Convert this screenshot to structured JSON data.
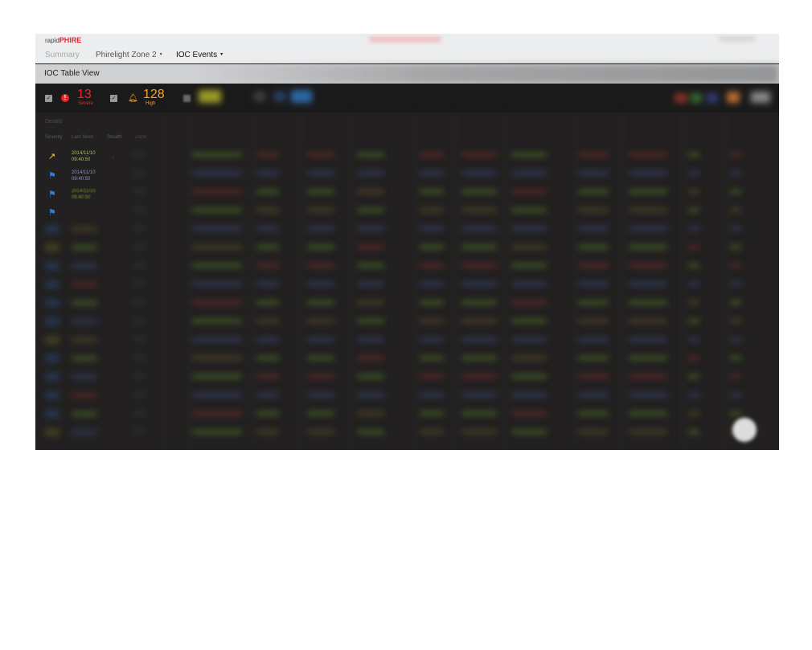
{
  "brand": {
    "prefix": "rapid",
    "name": "PHIRE"
  },
  "nav": {
    "tabs": [
      {
        "label": "Summary"
      },
      {
        "label": "Phirelight  Zone 2",
        "caret": "▾"
      },
      {
        "label": "IOC Events",
        "caret": "▾"
      }
    ]
  },
  "page": {
    "title": "IOC Table View"
  },
  "filters": {
    "severe": {
      "count": "13",
      "label": "Severe",
      "icon": "alert-circle-icon",
      "color": "#e8262e"
    },
    "high": {
      "count": "128",
      "label": "High",
      "icon": "bell-icon",
      "color": "#f6a21c"
    }
  },
  "table": {
    "section": "Details",
    "columns": [
      "Severity",
      "Last Seen",
      "Stealth",
      "Zone"
    ],
    "rows": [
      {
        "severity": "trend-up-icon",
        "last_seen_date": "2014/11/10",
        "last_seen_time": "09:40:50",
        "stealth": "-"
      },
      {
        "severity": "flag-icon",
        "last_seen_date": "2014/11/10",
        "last_seen_time": "09:40:50"
      },
      {
        "severity": "flag-icon",
        "last_seen_date": "2014/11/10",
        "last_seen_time": "09:40:50"
      },
      {
        "severity": "flag-icon"
      }
    ]
  }
}
